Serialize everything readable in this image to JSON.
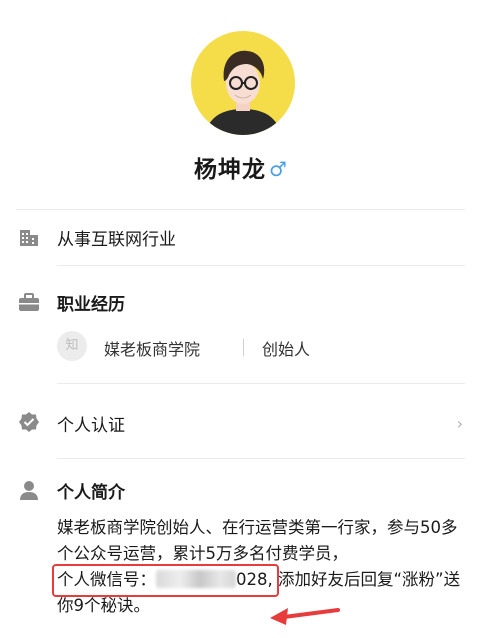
{
  "profile": {
    "name": "杨坤龙",
    "gender_symbol": "♂"
  },
  "industry": {
    "label": "从事互联网行业"
  },
  "experience": {
    "heading": "职业经历",
    "logo_char": "知",
    "company": "媒老板商学院",
    "role": "创始人"
  },
  "verification": {
    "label": "个人认证",
    "chevron": "›"
  },
  "bio": {
    "heading": "个人简介",
    "text_before": "媒老板商学院创始人、在行运营类第一行家，参与50多个公众号运营，累计5万多名付费学员，",
    "wechat_label": "个人微信号：",
    "wechat_suffix": "028,",
    "text_after": " 添加好友后回复“涨粉”送你9个秘诀。"
  },
  "icons": {
    "industry": "building-icon",
    "experience": "briefcase-icon",
    "verification": "verified-badge-icon",
    "bio": "person-icon"
  },
  "colors": {
    "avatar_bg": "#f5dd4a",
    "gender": "#4aa0e6",
    "highlight": "#e63c3c",
    "icon_gray": "#8a8a8a"
  }
}
